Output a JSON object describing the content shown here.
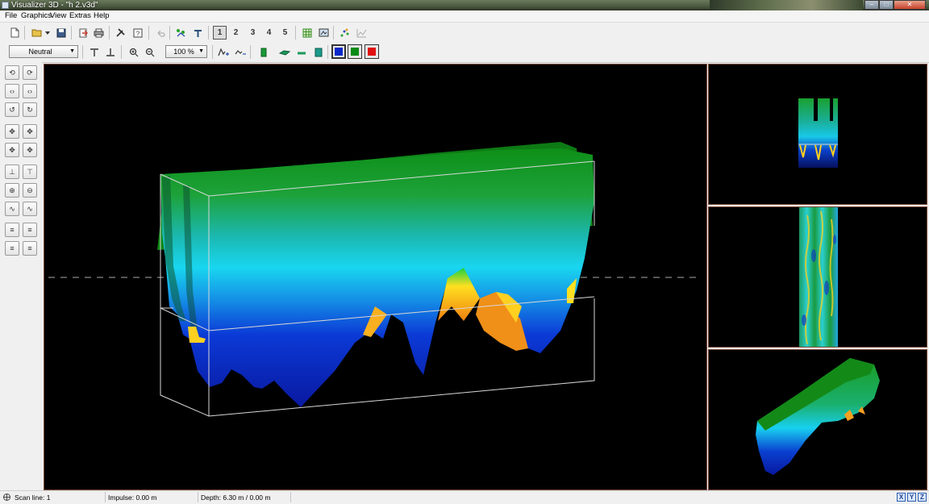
{
  "window": {
    "title": "Visualizer 3D - \"h 2.v3d\"",
    "minimize": "–",
    "maximize": "□",
    "close": "✕"
  },
  "menu": [
    "File",
    "Graphics",
    "View",
    "Extras",
    "Help"
  ],
  "toolbar1": {
    "icons": [
      "new-file-icon",
      "open-file-icon",
      "dropdown-arrow-icon",
      "save-icon",
      "export-icon",
      "print-icon",
      "tools-icon",
      "help-icon",
      "undo-icon",
      "color-points-icon",
      "wand-icon"
    ],
    "numbers": [
      "1",
      "2",
      "3",
      "4",
      "5"
    ],
    "selected_number": "1"
  },
  "toolbar2": {
    "mode_dropdown": "Neutral",
    "zoom_dropdown": "100 %",
    "colors": {
      "blue": "#0a28c8",
      "green": "#0a8a16",
      "red": "#e01010"
    }
  },
  "status": {
    "scan_line": "Scan line: 1",
    "impulse": "Impulse: 0.00 m",
    "depth": "Depth: 6.30 m / 0.00 m",
    "axes": [
      "X",
      "Y",
      "Z"
    ]
  }
}
